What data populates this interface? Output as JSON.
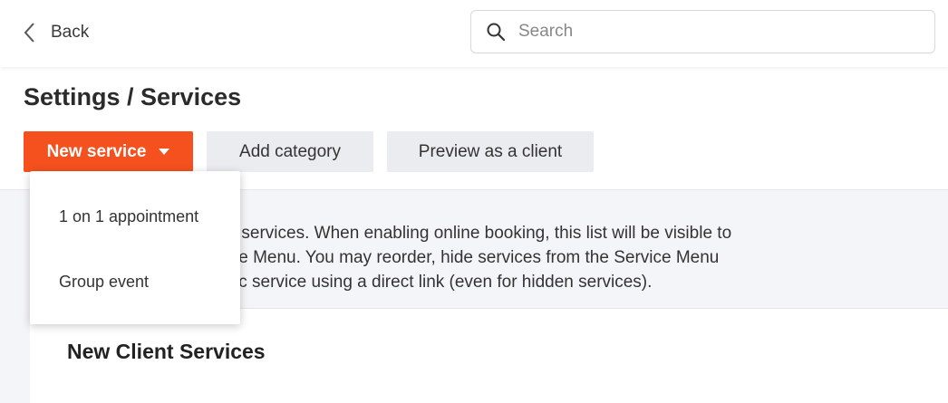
{
  "topbar": {
    "back_label": "Back",
    "search_placeholder": "Search"
  },
  "header": {
    "title": "Settings / Services",
    "buttons": {
      "new_service": "New service",
      "add_category": "Add category",
      "preview": "Preview as a client"
    }
  },
  "dropdown": {
    "items": [
      {
        "label": "1 on 1 appointment"
      },
      {
        "label": "Group event"
      }
    ]
  },
  "description": {
    "lines": [
      "ed services. When enabling online booking, this list will be visible to",
      "vice Menu. You may reorder, hide services from the Service Menu",
      "cific service using a direct link (even for hidden services)."
    ]
  },
  "section": {
    "title": "New Client Services"
  },
  "colors": {
    "primary": "#f4511e",
    "secondary_button": "#ebecf0",
    "background": "#f4f5f8"
  }
}
